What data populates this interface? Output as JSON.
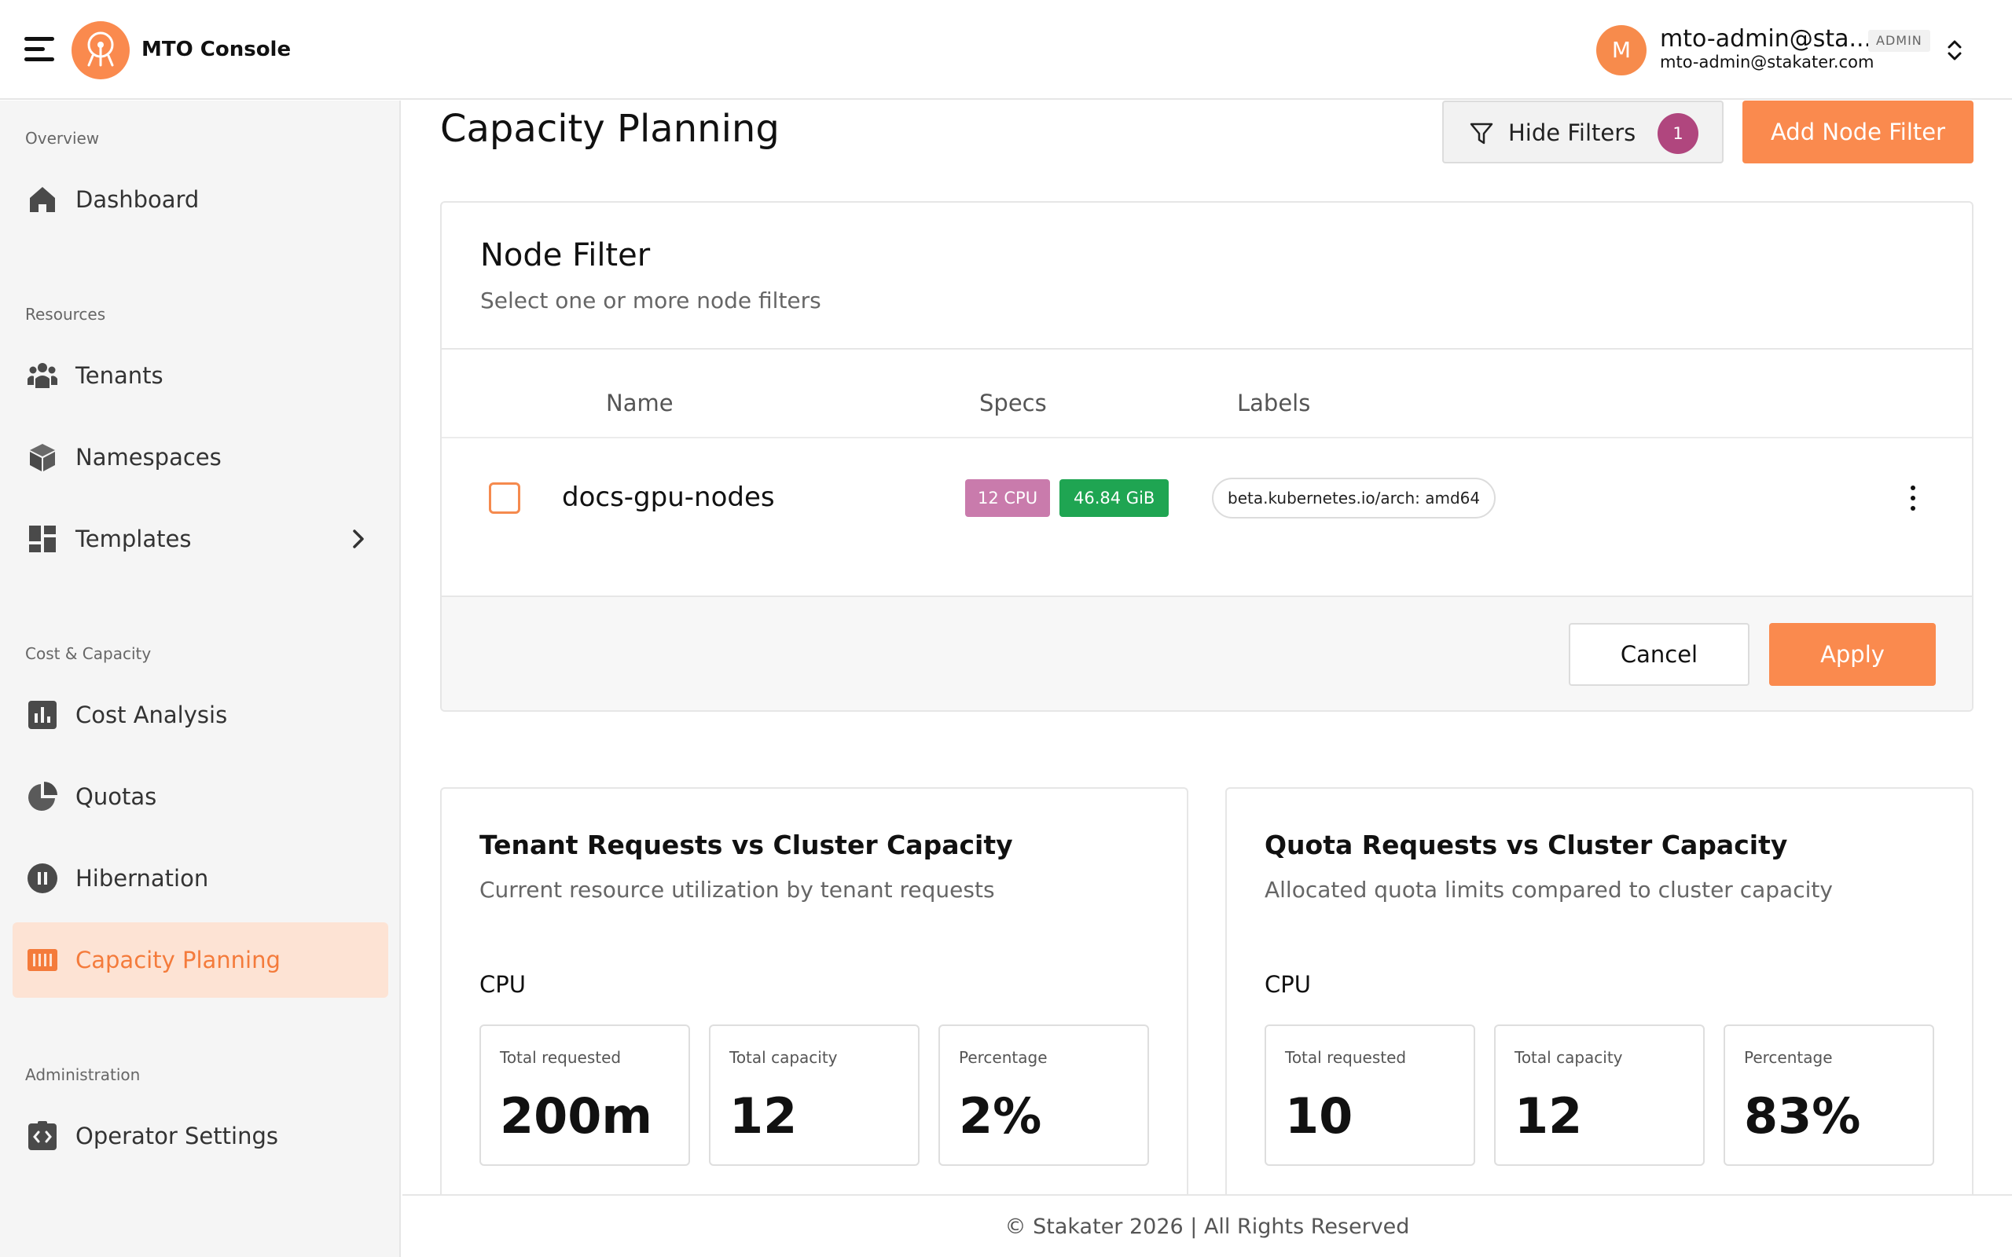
{
  "header": {
    "app_title": "MTO Console",
    "user": {
      "avatar_initial": "M",
      "name": "mto-admin@sta...",
      "email": "mto-admin@stakater.com",
      "role_badge": "ADMIN"
    }
  },
  "sidebar": {
    "sections": [
      {
        "title": "Overview",
        "items": [
          {
            "label": "Dashboard",
            "icon": "home-icon"
          }
        ]
      },
      {
        "title": "Resources",
        "items": [
          {
            "label": "Tenants",
            "icon": "users-group-icon"
          },
          {
            "label": "Namespaces",
            "icon": "cube-icon"
          },
          {
            "label": "Templates",
            "icon": "dashboard-grid-icon",
            "has_chevron": true
          }
        ]
      },
      {
        "title": "Cost & Capacity",
        "items": [
          {
            "label": "Cost Analysis",
            "icon": "bar-chart-icon"
          },
          {
            "label": "Quotas",
            "icon": "pie-chart-icon"
          },
          {
            "label": "Hibernation",
            "icon": "pause-icon"
          },
          {
            "label": "Capacity Planning",
            "icon": "capacity-bars-icon",
            "active": true
          }
        ]
      },
      {
        "title": "Administration",
        "items": [
          {
            "label": "Operator Settings",
            "icon": "code-settings-icon"
          }
        ]
      }
    ]
  },
  "page": {
    "title": "Capacity Planning",
    "hide_filters_label": "Hide Filters",
    "filter_count": "1",
    "add_node_filter_label": "Add Node Filter"
  },
  "node_filter": {
    "title": "Node Filter",
    "subtitle": "Select one or more node filters",
    "columns": [
      "Name",
      "Specs",
      "Labels"
    ],
    "rows": [
      {
        "name": "docs-gpu-nodes",
        "cpu": "12 CPU",
        "memory": "46.84 GiB",
        "label": "beta.kubernetes.io/arch: amd64",
        "checked": false
      }
    ],
    "cancel_label": "Cancel",
    "apply_label": "Apply"
  },
  "comparisons": [
    {
      "title": "Tenant Requests vs Cluster Capacity",
      "subtitle": "Current resource utilization by tenant requests",
      "metric": "CPU",
      "stats": [
        {
          "label": "Total requested",
          "value": "200m"
        },
        {
          "label": "Total capacity",
          "value": "12"
        },
        {
          "label": "Percentage",
          "value": "2%"
        }
      ]
    },
    {
      "title": "Quota Requests vs Cluster Capacity",
      "subtitle": "Allocated quota limits compared to cluster capacity",
      "metric": "CPU",
      "stats": [
        {
          "label": "Total requested",
          "value": "10"
        },
        {
          "label": "Total capacity",
          "value": "12"
        },
        {
          "label": "Percentage",
          "value": "83%"
        }
      ]
    }
  ],
  "footer": {
    "text": "© Stakater 2026 | All Rights Reserved"
  },
  "colors": {
    "accent": "#fa8a4e",
    "active_bg": "#fde3d4",
    "badge": "#b0467e",
    "cpu_chip": "#c97bac",
    "mem_chip": "#1fa552"
  }
}
